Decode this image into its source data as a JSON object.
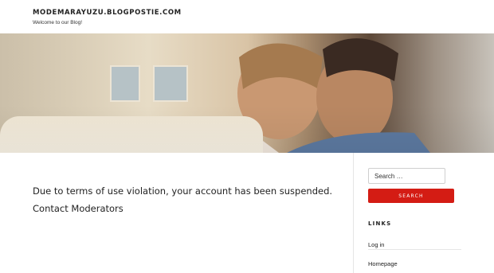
{
  "header": {
    "site_title": "MODEMARAYUZU.BLOGPOSTIE.COM",
    "site_description": "Welcome to our Blog!"
  },
  "hero": {
    "image_description": "couple-photo"
  },
  "main": {
    "message": "Due to terms of use violation, your account has been suspended.",
    "contact_link": "Contact Moderators"
  },
  "sidebar": {
    "search": {
      "placeholder": "Search …",
      "button_label": "SEARCH"
    },
    "links_title": "LINKS",
    "links": [
      {
        "label": "Log in"
      },
      {
        "label": "Homepage"
      }
    ]
  },
  "colors": {
    "accent": "#d41c14",
    "text": "#222222",
    "background": "#ffffff"
  }
}
